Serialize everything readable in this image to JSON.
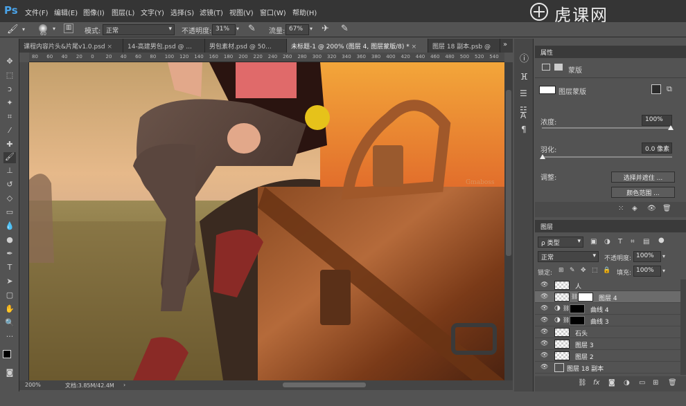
{
  "app": {
    "logo": "Ps"
  },
  "menu": [
    "文件(F)",
    "编辑(E)",
    "图像(I)",
    "图层(L)",
    "文字(Y)",
    "选择(S)",
    "滤镜(T)",
    "视图(V)",
    "窗口(W)",
    "帮助(H)"
  ],
  "watermark": "虎课网",
  "options": {
    "brush_size": "60",
    "mode_label": "模式:",
    "mode_value": "正常",
    "opacity_label": "不透明度:",
    "opacity_value": "31%",
    "flow_label": "流量:",
    "flow_value": "67%"
  },
  "tabs": [
    {
      "label": "课程内容片头&片尾v1.0.psd",
      "active": false
    },
    {
      "label": "14-高建男包.psd @ ...",
      "active": false
    },
    {
      "label": "男包素材.psd @ 50...",
      "active": false
    },
    {
      "label": "未标题-1 @ 200% (图层 4, 图层蒙版/8) *",
      "active": true
    },
    {
      "label": "图层 18 副本.psb @",
      "active": false
    }
  ],
  "ruler_h": [
    "80",
    "60",
    "40",
    "20",
    "0",
    "20",
    "40",
    "60",
    "80",
    "100",
    "120",
    "140",
    "160",
    "180",
    "200",
    "220",
    "240",
    "260",
    "280",
    "300",
    "320",
    "340",
    "360",
    "380",
    "400",
    "420",
    "440",
    "460",
    "480",
    "500",
    "520",
    "540"
  ],
  "status": {
    "zoom": "200%",
    "doc": "文档:3.85M/42.4M"
  },
  "properties": {
    "title": "属性",
    "mask_type": "蒙版",
    "layer_mask_label": "图层蒙版",
    "density_label": "浓度:",
    "density_value": "100%",
    "feather_label": "羽化:",
    "feather_value": "0.0 像素",
    "adjust_label": "调整:",
    "select_mask_button": "选择并遮住 ...",
    "color_range_button": "颜色范围 ..."
  },
  "layers_panel": {
    "title": "图层",
    "filter_kind": "类型",
    "blend_mode": "正常",
    "opacity_label": "不透明度:",
    "opacity_value": "100%",
    "lock_label": "锁定:",
    "fill_label": "填充:",
    "fill_value": "100%",
    "layers": [
      {
        "name": "人",
        "type": "pixel",
        "selected": false
      },
      {
        "name": "图层 4",
        "type": "masked",
        "selected": true
      },
      {
        "name": "曲线 4",
        "type": "curves",
        "selected": false
      },
      {
        "name": "曲线 3",
        "type": "curves",
        "selected": false
      },
      {
        "name": "石头",
        "type": "pixel",
        "selected": false
      },
      {
        "name": "图层 3",
        "type": "pixel",
        "selected": false
      },
      {
        "name": "图层 2",
        "type": "pixel",
        "selected": false
      },
      {
        "name": "图层 18 副本",
        "type": "smart",
        "selected": false
      }
    ]
  },
  "colors": {
    "accent": "#4aa3e8",
    "brush_cursor": "#e6c21a"
  }
}
